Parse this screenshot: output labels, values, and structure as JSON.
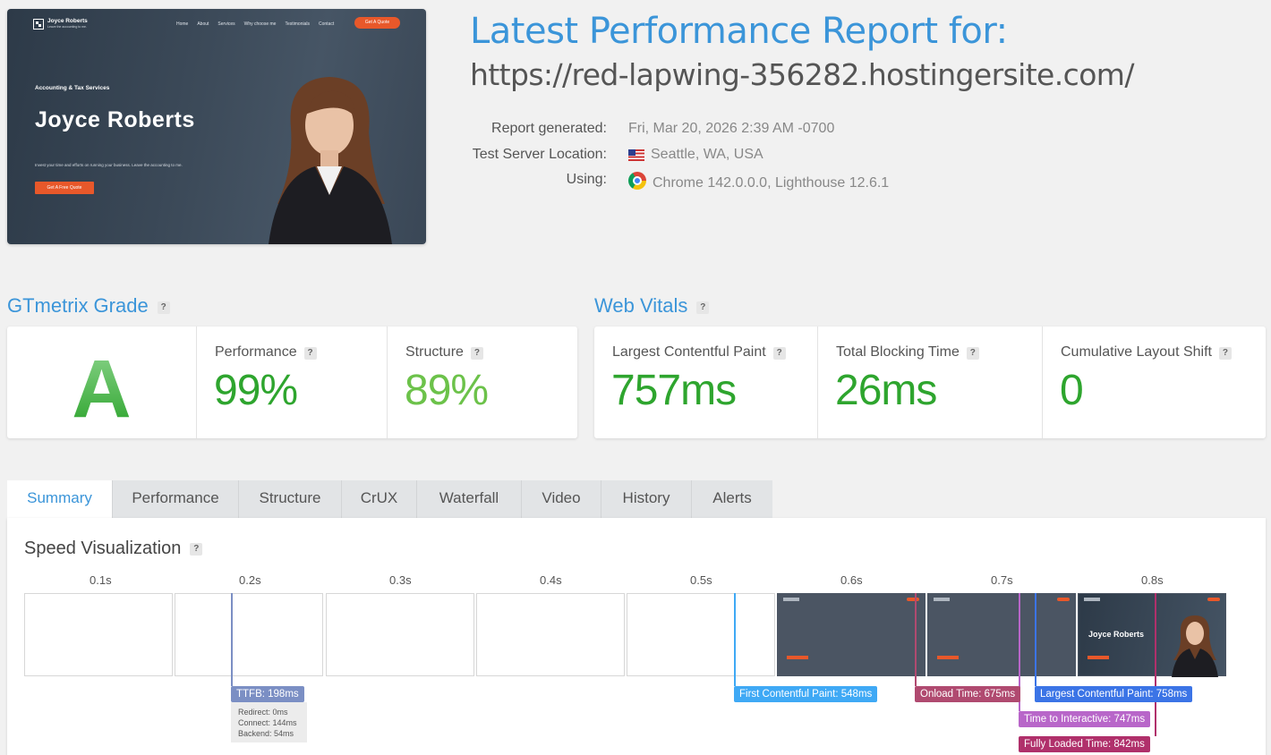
{
  "preview": {
    "brand": "Joyce Roberts",
    "brand_sub": "Leave the accounting to me.",
    "menu": [
      "Home",
      "About",
      "Services",
      "Why choose me",
      "Testimonials",
      "Contact"
    ],
    "nav_cta": "Get A Quote",
    "tagline": "Accounting & Tax Services",
    "hero_title": "Joyce Roberts",
    "hero_desc": "Invest your time and efforts on running your business. Leave the accounting to me.",
    "hero_cta": "Get A Free Quote"
  },
  "header": {
    "title": "Latest Performance Report for:",
    "url": "https://red-lapwing-356282.hostingersite.com/"
  },
  "meta": {
    "generated_label": "Report generated:",
    "generated_value": "Fri, Mar 20, 2026 2:39 AM -0700",
    "location_label": "Test Server Location:",
    "location_value": "Seattle, WA, USA",
    "using_label": "Using:",
    "using_value": "Chrome 142.0.0.0, Lighthouse 12.6.1",
    "location_icon": "us-flag-icon",
    "using_icon": "chrome-icon"
  },
  "grade": {
    "title": "GTmetrix Grade",
    "letter": "A",
    "performance_label": "Performance",
    "performance_value": "99%",
    "structure_label": "Structure",
    "structure_value": "89%"
  },
  "vitals": {
    "title": "Web Vitals",
    "lcp_label": "Largest Contentful Paint",
    "lcp_value": "757ms",
    "tbt_label": "Total Blocking Time",
    "tbt_value": "26ms",
    "cls_label": "Cumulative Layout Shift",
    "cls_value": "0"
  },
  "tabs": [
    "Summary",
    "Performance",
    "Structure",
    "CrUX",
    "Waterfall",
    "Video",
    "History",
    "Alerts"
  ],
  "active_tab": "Summary",
  "speed": {
    "title": "Speed Visualization",
    "ticks": [
      "0.1s",
      "0.2s",
      "0.3s",
      "0.4s",
      "0.5s",
      "0.6s",
      "0.7s",
      "0.8s"
    ],
    "frame_hero_title": "Joyce Roberts",
    "markers": {
      "ttfb": "TTFB: 198ms",
      "fcp": "First Contentful Paint: 548ms",
      "onload": "Onload Time: 675ms",
      "lcp": "Largest Contentful Paint: 758ms",
      "tti": "Time to Interactive: 747ms",
      "fully": "Fully Loaded Time: 842ms"
    },
    "ttfb_detail": {
      "redirect": "Redirect: 0ms",
      "connect": "Connect: 144ms",
      "backend": "Backend: 54ms"
    }
  },
  "colors": {
    "accent": "#3b95d9",
    "grade_green": "#3aaa3a",
    "value_green": "#2ea52e",
    "structure_green": "#6cc24a",
    "ttfb": "#7b8fc4",
    "fcp": "#3fa9f5",
    "onload": "#b04a70",
    "lcp": "#3b74e6",
    "tti": "#b866c9",
    "fully": "#b0306b"
  }
}
